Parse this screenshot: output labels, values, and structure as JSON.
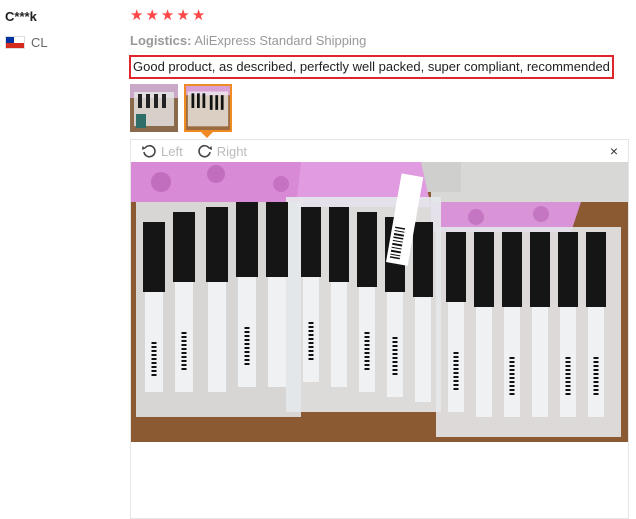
{
  "reviewer": {
    "name": "C***k",
    "country_code": "CL"
  },
  "rating": {
    "stars": 5,
    "star_color": "#ff4747"
  },
  "logistics": {
    "label": "Logistics:",
    "value": "AliExpress Standard Shipping"
  },
  "feedback": {
    "text": "Good product, as described, perfectly well packed, super compliant, recommended",
    "highlight_color": "#e0262d"
  },
  "thumbnails": {
    "count": 2,
    "active_index": 1,
    "active_border_color": "#f08a24"
  },
  "viewer": {
    "rotate_left_label": "Left",
    "rotate_right_label": "Right",
    "close_symbol": "×"
  },
  "icons": [
    "chile-flag-icon",
    "star-icon",
    "rotate-left-icon",
    "rotate-right-icon",
    "close-icon"
  ]
}
